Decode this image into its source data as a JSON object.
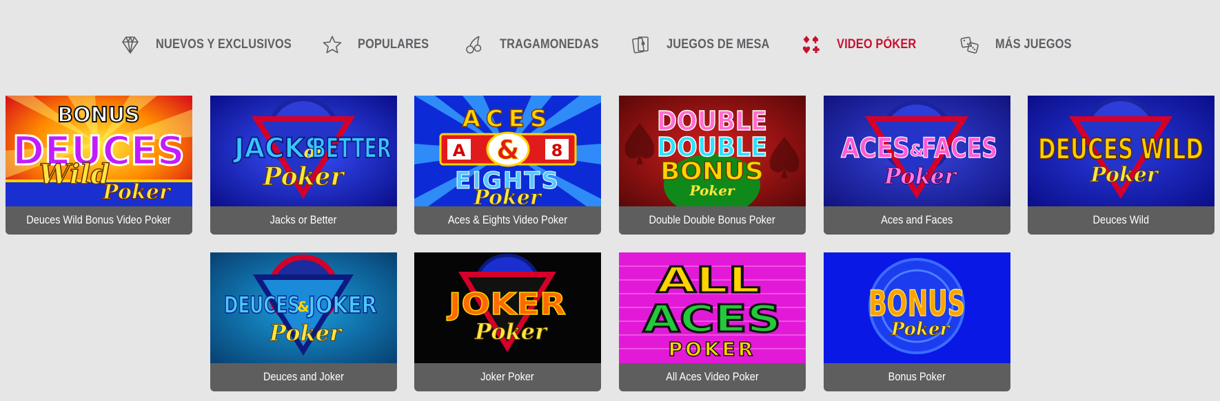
{
  "nav": {
    "items": [
      {
        "label": "NUEVOS Y EXCLUSIVOS",
        "icon": "diamond-icon"
      },
      {
        "label": "POPULARES",
        "icon": "star-icon"
      },
      {
        "label": "TRAGAMONEDAS",
        "icon": "cherries-icon"
      },
      {
        "label": "JUEGOS DE MESA",
        "icon": "playing-cards-icon"
      },
      {
        "label": "VIDEO PÓKER",
        "icon": "card-suits-icon",
        "active": true
      },
      {
        "label": "MÁS JUEGOS",
        "icon": "dice-icon"
      }
    ],
    "active_color": "#c8102e",
    "text_color": "#5d5f63"
  },
  "games": [
    {
      "title": "Deuces Wild Bonus Video Poker",
      "logo": [
        "BONUS",
        "DEUCES",
        "Wild",
        "Poker"
      ]
    },
    {
      "title": "Jacks or Better",
      "logo": [
        "JACKS",
        "or",
        "BETTER",
        "Poker"
      ]
    },
    {
      "title": "Aces & Eights Video Poker",
      "logo": [
        "ACES",
        "A",
        "&",
        "8",
        "EIGHTS",
        "Poker"
      ]
    },
    {
      "title": "Double Double Bonus Poker",
      "logo": [
        "DOUBLE",
        "DOUBLE",
        "BONUS",
        "Poker"
      ]
    },
    {
      "title": "Aces and Faces",
      "logo": [
        "ACES",
        "&",
        "FACES",
        "Poker"
      ]
    },
    {
      "title": "Deuces Wild",
      "logo": [
        "DEUCES WILD",
        "Poker"
      ]
    },
    {
      "title": "Deuces and Joker",
      "logo": [
        "DEUCES",
        "&",
        "JOKER",
        "Poker"
      ]
    },
    {
      "title": "Joker Poker",
      "logo": [
        "JOKER",
        "Poker"
      ]
    },
    {
      "title": "All Aces Video Poker",
      "logo": [
        "ALL",
        "ACES",
        "POKER"
      ]
    },
    {
      "title": "Bonus Poker",
      "logo": [
        "BONUS",
        "Poker"
      ]
    }
  ]
}
